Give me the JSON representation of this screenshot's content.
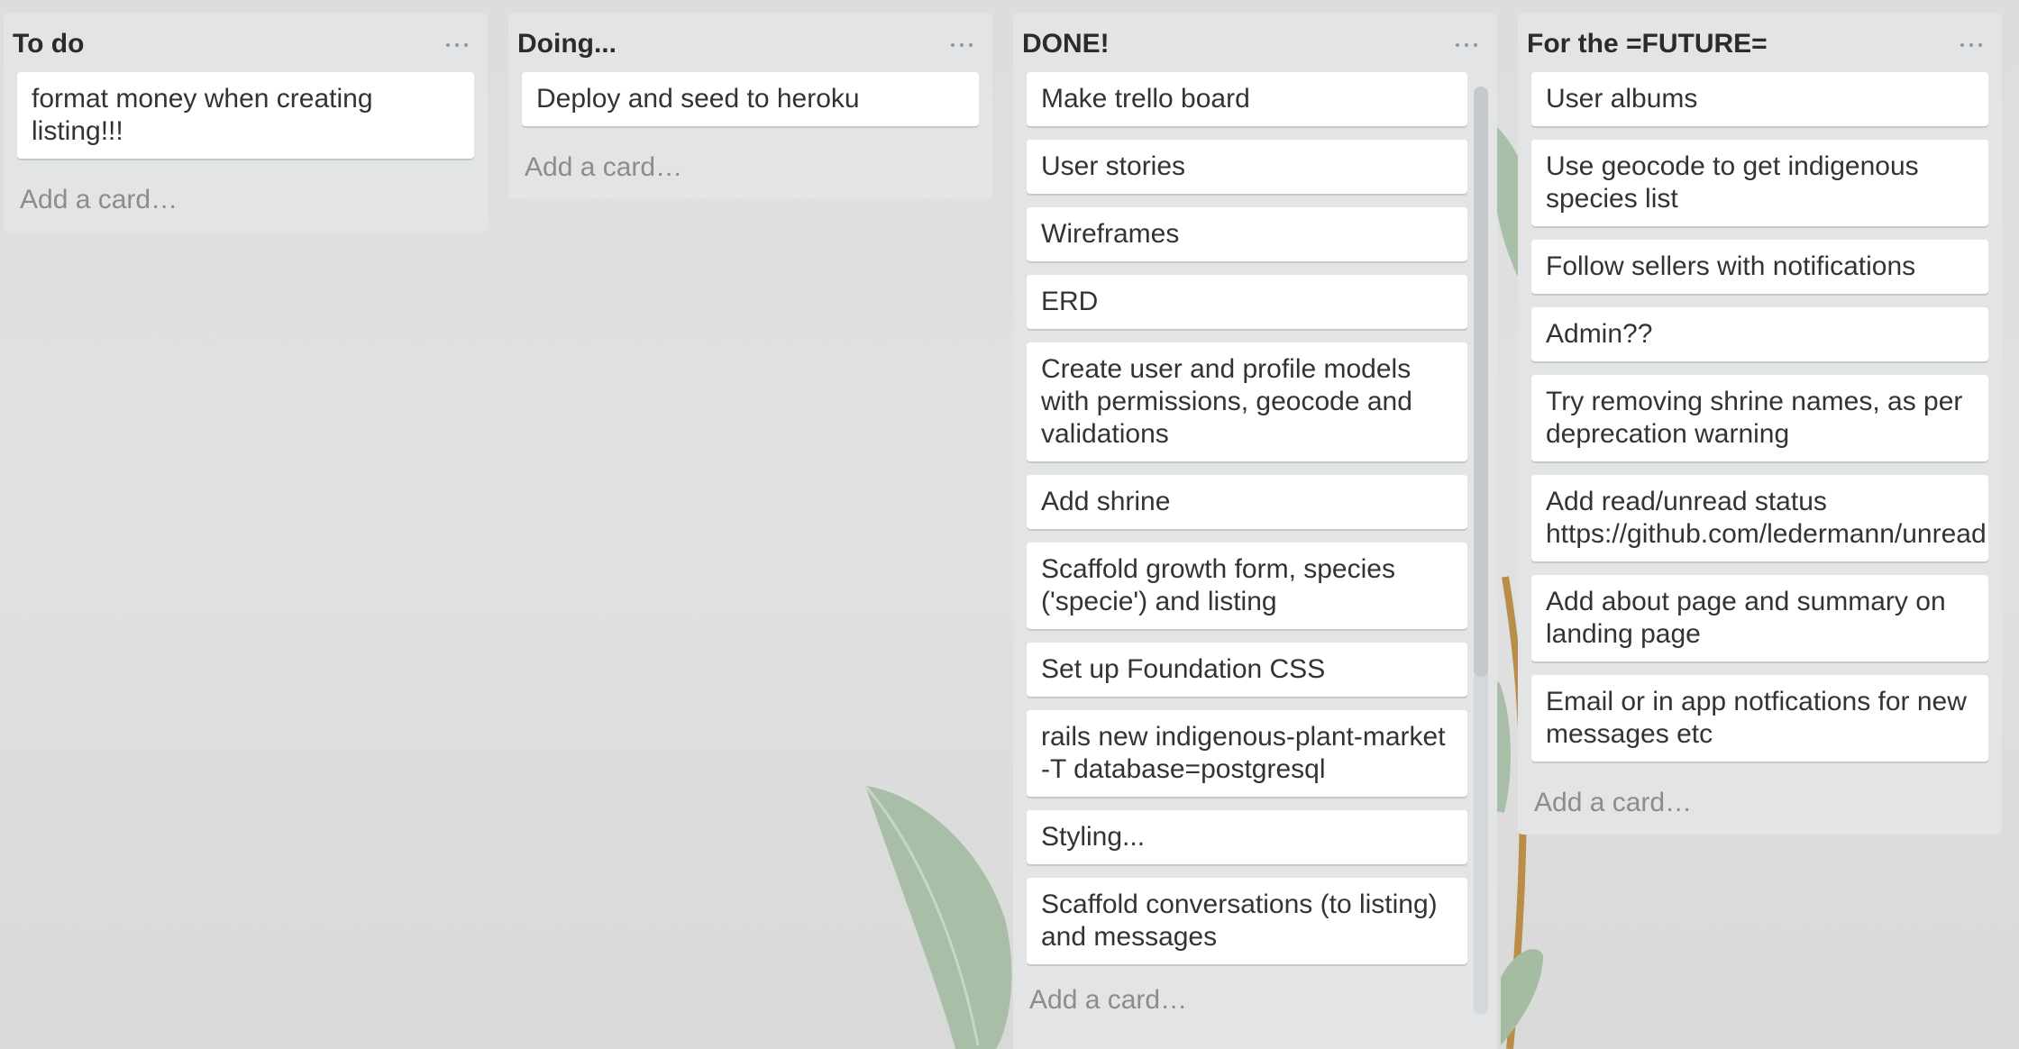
{
  "lists": [
    {
      "title": "To do",
      "cards": [
        "format money when creating listing!!!"
      ],
      "add_card": "Add a card…"
    },
    {
      "title": "Doing...",
      "cards": [
        "Deploy and seed to heroku"
      ],
      "add_card": "Add a card…"
    },
    {
      "title": "DONE!",
      "cards": [
        "Make trello board",
        "User stories",
        "Wireframes",
        "ERD",
        "Create user and profile models with permissions, geocode and validations",
        "Add shrine",
        "Scaffold growth form, species ('specie') and listing",
        "Set up Foundation CSS",
        "rails new indigenous-plant-market -T database=postgresql",
        "Styling...",
        "Scaffold conversations (to listing) and messages"
      ],
      "add_card": "Add a card…"
    },
    {
      "title": "For the =FUTURE=",
      "cards": [
        "User albums",
        "Use geocode to get indigenous species list",
        "Follow sellers with notifications",
        "Admin??",
        "Try removing shrine names, as per deprecation warning",
        "Add read/unread status https://github.com/ledermann/unread",
        "Add about page and summary on landing page",
        "Email or in app notfications for new messages etc"
      ],
      "add_card": "Add a card…"
    }
  ],
  "icons": {
    "list_menu": "more-horizontal-icon",
    "background": "eucalyptus-leaf-icon"
  },
  "colors": {
    "list_bg": "#e2e4e6",
    "card_bg": "#ffffff",
    "placeholder_text": "#8c8c8c"
  }
}
